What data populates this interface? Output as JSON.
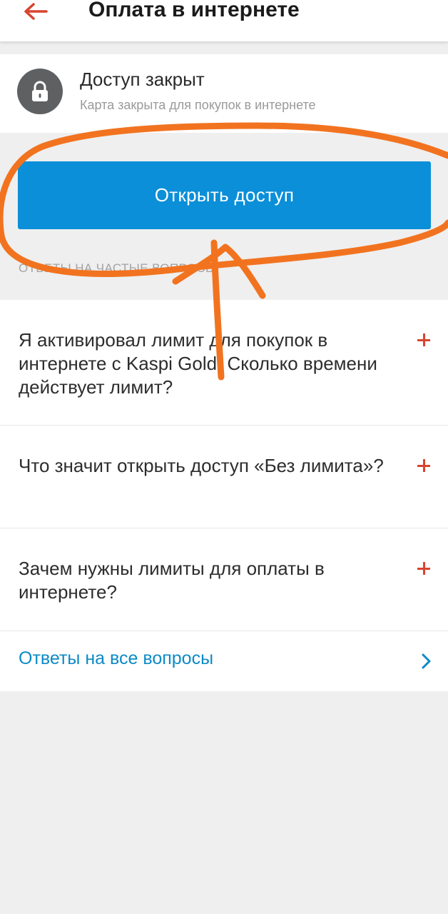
{
  "header": {
    "title": "Оплата в интернете"
  },
  "status": {
    "title": "Доступ закрыт",
    "subtitle": "Карта закрыта для покупок в интернете"
  },
  "open_button": {
    "label": "Открыть доступ"
  },
  "faq": {
    "heading": "Ответы на частые вопросы",
    "items": [
      {
        "question": "Я активировал лимит для покупок в интернете с Kaspi Gold. Сколько времени действует лимит?"
      },
      {
        "question": "Что значит открыть доступ «Без лимита»?"
      },
      {
        "question": "Зачем нужны лимиты для оплаты в интернете?"
      }
    ],
    "all_answers_label": "Ответы на все вопросы"
  },
  "colors": {
    "accent_blue": "#0a8fd8",
    "link_blue": "#0c8ac6",
    "plus_red": "#d8442f",
    "annotation_orange": "#f2731f"
  },
  "icons": {
    "back": "arrow-left-icon",
    "lock": "lock-icon",
    "expand": "plus-icon",
    "chevron": "chevron-right-icon"
  }
}
